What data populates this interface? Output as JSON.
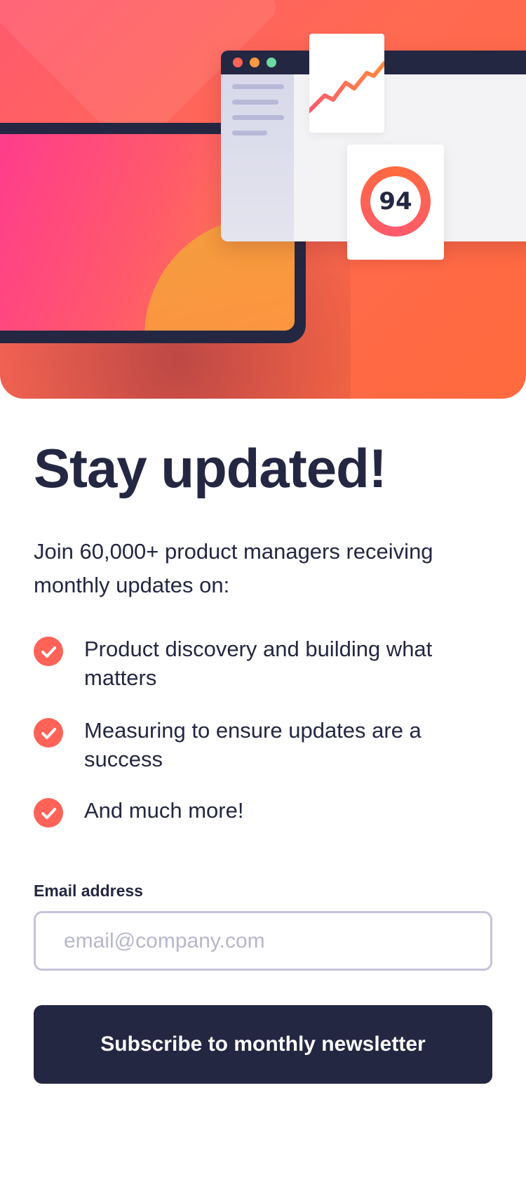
{
  "hero": {
    "score_value": "94",
    "colors": {
      "gradient_start": "#ff5a6e",
      "gradient_end": "#ff6a3d",
      "navy": "#242742"
    }
  },
  "content": {
    "title": "Stay updated!",
    "intro": "Join 60,000+ product managers receiving monthly updates on:",
    "features": [
      {
        "icon": "check-circle-icon",
        "text": "Product discovery and building what matters"
      },
      {
        "icon": "check-circle-icon",
        "text": "Measuring to ensure updates are a success"
      },
      {
        "icon": "check-circle-icon",
        "text": "And much more!"
      }
    ]
  },
  "form": {
    "email_label": "Email address",
    "email_value": "",
    "email_placeholder": "email@company.com",
    "submit_label": "Subscribe to monthly newsletter"
  },
  "colors": {
    "accent": "#ff6257",
    "text": "#242742",
    "input_border": "#c4c3d8",
    "placeholder": "#b7b6cc"
  }
}
